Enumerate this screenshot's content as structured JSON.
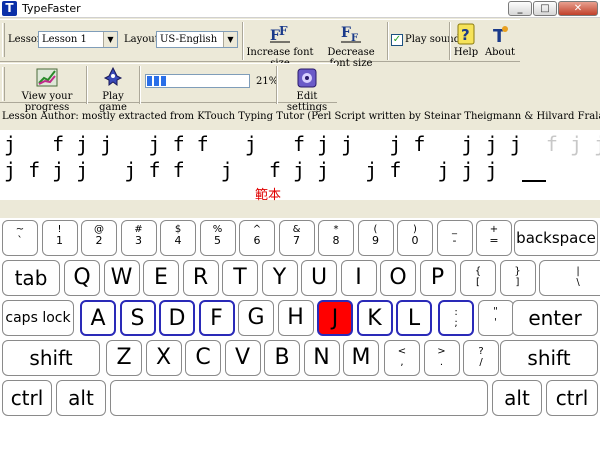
{
  "window": {
    "title": "TypeFaster",
    "app_icon": "T"
  },
  "toolbar": {
    "lesson_label": "Lesson:",
    "lesson_value": "Lesson 1",
    "layout_label": "Layout:",
    "layout_value": "US-English",
    "increase_font_label": "Increase font size",
    "decrease_font_label": "Decrease font size",
    "play_sounds_label": "Play sounds",
    "play_sounds_checked": true,
    "help_label": "Help",
    "about_label": "About",
    "view_progress_label": "View your progress",
    "play_game_label": "Play game",
    "progress_value": 0.21,
    "progress_text": "21%",
    "edit_settings_label": "Edit settings"
  },
  "author_text": "Lesson Author: mostly extracted from KTouch Typing Tutor (Perl Script written by Steinar Theigmann & Hilvard Fraland)",
  "exercise": {
    "line1_typed": "j   f j j   j f f   j   f j j   j f   j j j  ",
    "line1_ghost": "f j j f",
    "line2": "j f j j   j f f   j   f j j   j f   j j j  ",
    "sample_label": "範本"
  },
  "keyboard": {
    "row1": [
      {
        "top": "~",
        "bot": "`"
      },
      {
        "top": "!",
        "bot": "1"
      },
      {
        "top": "@",
        "bot": "2"
      },
      {
        "top": "#",
        "bot": "3"
      },
      {
        "top": "$",
        "bot": "4"
      },
      {
        "top": "%",
        "bot": "5"
      },
      {
        "top": "^",
        "bot": "6"
      },
      {
        "top": "&",
        "bot": "7"
      },
      {
        "top": "*",
        "bot": "8"
      },
      {
        "top": "(",
        "bot": "9"
      },
      {
        "top": ")",
        "bot": "0"
      },
      {
        "top": "_",
        "bot": "-"
      },
      {
        "top": "+",
        "bot": "="
      }
    ],
    "backspace": "backspace",
    "tab": "tab",
    "row2": [
      "Q",
      "W",
      "E",
      "R",
      "T",
      "Y",
      "U",
      "I",
      "O",
      "P"
    ],
    "row2_punct": [
      {
        "top": "{",
        "bot": "["
      },
      {
        "top": "}",
        "bot": "]"
      },
      {
        "top": "|",
        "bot": "\\"
      }
    ],
    "caps_lock": "caps lock",
    "row3": [
      "A",
      "S",
      "D",
      "F",
      "G",
      "H",
      "J",
      "K",
      "L"
    ],
    "row3_punct": [
      {
        "top": ":",
        "bot": ";"
      },
      {
        "top": "\"",
        "bot": "'"
      }
    ],
    "enter": "enter",
    "shift_left": "shift",
    "row4": [
      "Z",
      "X",
      "C",
      "V",
      "B",
      "N",
      "M"
    ],
    "row4_punct": [
      {
        "top": "<",
        "bot": ","
      },
      {
        "top": ">",
        "bot": "."
      },
      {
        "top": "?",
        "bot": "/"
      }
    ],
    "shift_right": "shift",
    "ctrl_left": "ctrl",
    "alt_left": "alt",
    "alt_right": "alt",
    "ctrl_right": "ctrl",
    "active_key": "J",
    "active_color": "#ff0000",
    "home_border_color": "#2a2ab8"
  }
}
